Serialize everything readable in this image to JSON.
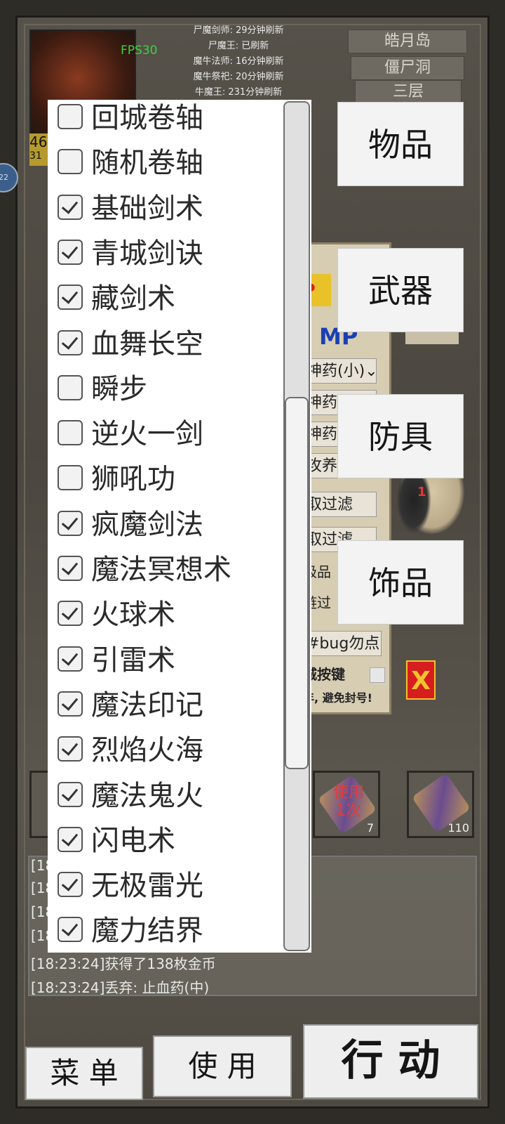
{
  "hud": {
    "fps": "FPS30",
    "level_text": "46",
    "level_sub": "31",
    "side_badge": "22",
    "boss_timers": [
      "尸魔剑师: 29分钟刷新",
      "尸魔王: 已刷新",
      "魔牛法师: 16分钟刷新",
      "魔牛祭祀: 20分钟刷新",
      "牛魔王: 231分钟刷新"
    ],
    "locations": [
      "皓月岛",
      "僵尸洞",
      "三层"
    ]
  },
  "background_panel": {
    "header_text": "P会",
    "mp_label": "MP",
    "rows": [
      "神药(小)⌄",
      "神药",
      "神药",
      "攻养",
      "取过滤",
      "取过滤",
      "极品",
      "链过"
    ],
    "bug_text": "#bug勿点)",
    "shortcut_text": "城按键",
    "warning_text": "年, 避免封号!",
    "close_label": "X",
    "enemy_label": "1"
  },
  "item_slots": [
    {
      "label": "使用\n1次",
      "count": "7"
    },
    {
      "label": "",
      "count": "110"
    }
  ],
  "log": {
    "lines": [
      "[18",
      "[18",
      "[18",
      "[18",
      "[18:23:24]获得了138枚金币",
      "[18:23:24]丢弃: 止血药(中)"
    ]
  },
  "bottom": {
    "menu": "菜 单",
    "use": "使 用",
    "action": "行 动"
  },
  "filter_list": {
    "items": [
      {
        "label": "回城卷轴",
        "checked": false
      },
      {
        "label": "随机卷轴",
        "checked": false
      },
      {
        "label": "基础剑术",
        "checked": true
      },
      {
        "label": "青城剑诀",
        "checked": true
      },
      {
        "label": "藏剑术",
        "checked": true
      },
      {
        "label": "血舞长空",
        "checked": true
      },
      {
        "label": "瞬步",
        "checked": false
      },
      {
        "label": "逆火一剑",
        "checked": false
      },
      {
        "label": "狮吼功",
        "checked": false
      },
      {
        "label": "疯魔剑法",
        "checked": true
      },
      {
        "label": "魔法冥想术",
        "checked": true
      },
      {
        "label": "火球术",
        "checked": true
      },
      {
        "label": "引雷术",
        "checked": true
      },
      {
        "label": "魔法印记",
        "checked": true
      },
      {
        "label": "烈焰火海",
        "checked": true
      },
      {
        "label": "魔法鬼火",
        "checked": true
      },
      {
        "label": "闪电术",
        "checked": true
      },
      {
        "label": "无极雷光",
        "checked": true
      },
      {
        "label": "魔力结界",
        "checked": true
      }
    ],
    "scroll_fraction": 0.62
  },
  "categories": [
    "物品",
    "武器",
    "防具",
    "饰品"
  ]
}
